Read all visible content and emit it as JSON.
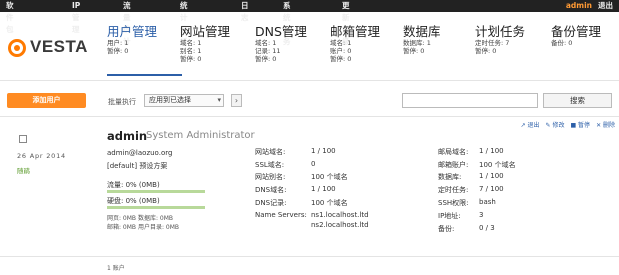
{
  "topnav": {
    "items": [
      "软件包",
      "IP管理",
      "流量统计",
      "统计分析",
      "日志",
      "系统服务",
      "更新升级"
    ],
    "user": "admin",
    "logout": "退出"
  },
  "logo_text": "VESTA",
  "categories": [
    {
      "title": "用户管理",
      "lines": [
        "用户: 1",
        "暂停: 0"
      ]
    },
    {
      "title": "网站管理",
      "lines": [
        "域名: 1",
        "别名: 1",
        "暂停: 0"
      ]
    },
    {
      "title": "DNS管理",
      "lines": [
        "域名: 1",
        "记录: 11",
        "暂停: 0"
      ]
    },
    {
      "title": "邮箱管理",
      "lines": [
        "域名: 1",
        "账户: 0",
        "暂停: 0"
      ]
    },
    {
      "title": "数据库",
      "lines": [
        "数据库: 1",
        "暂停: 0"
      ]
    },
    {
      "title": "计划任务",
      "lines": [
        "定时任务: 7",
        "暂停: 0"
      ]
    },
    {
      "title": "备份管理",
      "lines": [
        "备份: 0"
      ]
    }
  ],
  "actions": {
    "add_user": "添加用户",
    "bulk_label": "批量执行",
    "bulk_selected": "应用到已选择",
    "bulk_go": "›",
    "search_button": "搜索"
  },
  "record": {
    "ops": [
      "↗ 退出",
      "✎ 修改",
      "■ 暂停",
      "✕ 删除"
    ],
    "date": "26 Apr 2014",
    "status_link": "随鹃",
    "username": "admin",
    "role": "System Administrator",
    "email": "admin@laozuo.org",
    "package": "[default] 预设方案",
    "bandwidth_label": "流量: 0% (0MB)",
    "bandwidth_fraction": 0.0,
    "disk_label": "硬盘: 0% (0MB)",
    "disk_fraction": 0.0,
    "mini1": "网页: 0MB 数据库: 0MB",
    "mini2": "邮箱: 0MB 用户目录: 0MB",
    "col1": [
      [
        "网站域名:",
        "1 / 100"
      ],
      [
        "SSL域名:",
        "0"
      ],
      [
        "网站别名:",
        "100 个域名"
      ],
      [
        "DNS域名:",
        "1 / 100"
      ],
      [
        "DNS记录:",
        "100 个域名"
      ],
      [
        "Name Servers:",
        "ns1.localhost.ltd"
      ],
      [
        "",
        "ns2.localhost.ltd"
      ]
    ],
    "col2": [
      [
        "邮局域名:",
        "1 / 100"
      ],
      [
        "邮箱账户:",
        "100 个域名"
      ],
      [
        "数据库:",
        "1 / 100"
      ],
      [
        "定时任务:",
        "7 / 100"
      ],
      [
        "SSH权限:",
        "bash"
      ],
      [
        "IP地址:",
        "3"
      ],
      [
        "备份:",
        "0 / 3"
      ]
    ]
  },
  "footer": "1 账户",
  "colors": {
    "accent": "#ff8b22",
    "link": "#2c5fa8",
    "bar": "#b8d99a"
  }
}
